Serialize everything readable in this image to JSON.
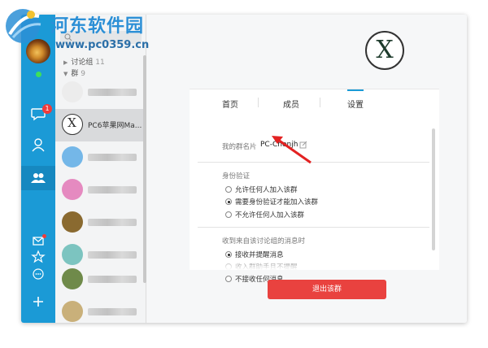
{
  "watermark": {
    "title": "河东软件园",
    "url": "www.pc0359.cn"
  },
  "leftbar": {
    "chat_badge": "1",
    "colors": {
      "bar": "#1b9ad6",
      "badge": "#ef3b3b",
      "online": "#3ee05a"
    },
    "icons": [
      "chat-icon",
      "contact-icon",
      "group-icon",
      "mail-icon",
      "star-icon",
      "more-icon",
      "add-icon"
    ]
  },
  "grouplist": {
    "discussion": {
      "label": "讨论组",
      "count": "11"
    },
    "groups": {
      "label": "群",
      "count": "9"
    },
    "selected_item": {
      "name": "PC6苹果网Ma..."
    }
  },
  "panel": {
    "tabs": [
      "首页",
      "成员",
      "设置"
    ],
    "active_tab": "设置",
    "card_name_label": "我的群名片",
    "card_name_value": "PC-Chenjh",
    "auth": {
      "title": "身份验证",
      "options": [
        "允许任何人加入该群",
        "需要身份验证才能加入该群",
        "不允许任何人加入该群"
      ],
      "selected": 1
    },
    "msg": {
      "title": "收到来自该讨论组的消息时",
      "options": [
        "接收并提醒消息",
        "收入群助手且不提醒",
        "不接收任何消息"
      ],
      "selected": 0
    },
    "quit_label": "退出该群"
  }
}
